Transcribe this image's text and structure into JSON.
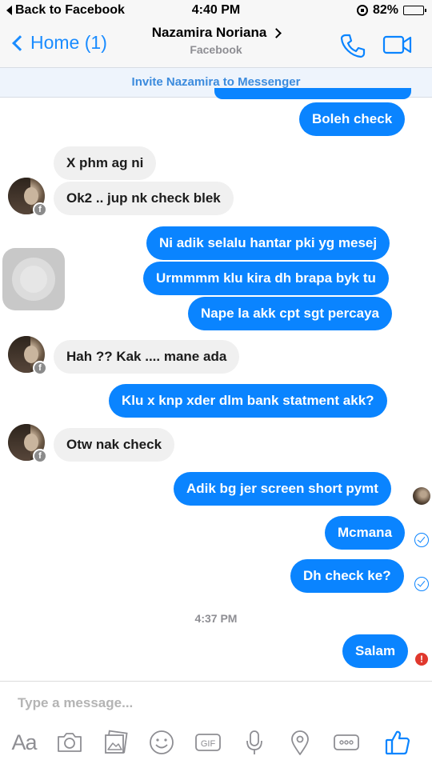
{
  "status_bar": {
    "back_label": "Back to Facebook",
    "time": "4:40 PM",
    "battery": "82%",
    "battery_level": 0.82
  },
  "nav": {
    "back_label": "Home (1)",
    "contact_name": "Nazamira Noriana",
    "subtitle": "Facebook"
  },
  "invite_banner": "Invite Nazamira to Messenger",
  "messages": [
    {
      "text": "Boleh check"
    },
    {
      "text": "X phm ag ni"
    },
    {
      "text": "Ok2 .. jup nk check blek"
    },
    {
      "text": "Ni adik selalu hantar pki yg mesej"
    },
    {
      "text": "Urmmmm klu kira dh brapa byk tu"
    },
    {
      "text": "Nape la akk cpt sgt percaya"
    },
    {
      "text": "Hah ?? Kak .... mane ada"
    },
    {
      "text": "Klu x knp xder dlm bank statment akk?"
    },
    {
      "text": "Otw nak check"
    },
    {
      "text": "Adik bg jer screen short pymt"
    },
    {
      "text": "Mcmana"
    },
    {
      "text": "Dh check ke?"
    },
    {
      "text": "Salam"
    }
  ],
  "timestamp": "4:37 PM",
  "composer": {
    "placeholder": "Type a message...",
    "aa_label": "Aa",
    "gif_label": "GIF"
  },
  "colors": {
    "accent": "#0a84ff",
    "incoming_bubble": "#f0f0f0",
    "banner_text": "#3c8bdd",
    "error": "#e0382d"
  }
}
